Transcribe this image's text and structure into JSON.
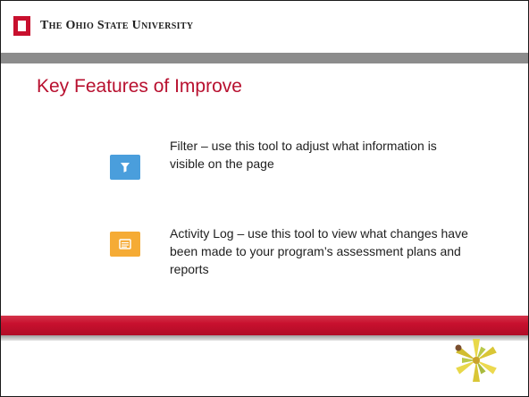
{
  "header": {
    "brand_text": "The Ohio State University"
  },
  "slide": {
    "title": "Key Features of Improve"
  },
  "features": [
    {
      "icon": "filter-icon",
      "tile_color": "#4a9edc",
      "text": "Filter – use this tool to adjust what information is visible on the page"
    },
    {
      "icon": "activity-log-icon",
      "tile_color": "#f5ab35",
      "text": "Activity Log – use this tool to view what changes have been made to your program’s assessment plans and reports"
    }
  ],
  "colors": {
    "title": "#b8102f",
    "brand_red": "#c8102e",
    "gray_band": "#8c8c8c"
  }
}
